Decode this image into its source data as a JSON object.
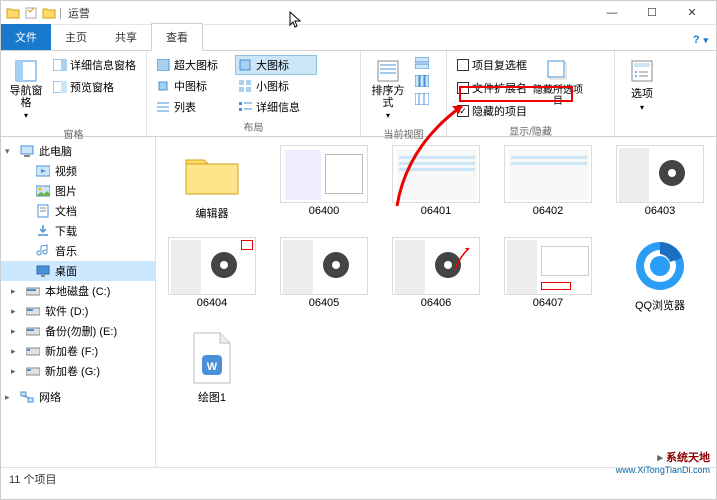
{
  "window": {
    "title": "运营",
    "minimize": "—",
    "maximize": "☐",
    "close": "✕"
  },
  "tabs": {
    "file": "文件",
    "home": "主页",
    "share": "共享",
    "view": "查看",
    "help": "?"
  },
  "ribbon": {
    "panes": {
      "nav_pane": "导航窗格",
      "detail_pane": "详细信息窗格",
      "preview_pane": "预览窗格",
      "label": "窗格"
    },
    "layout": {
      "extra_large": "超大图标",
      "large": "大图标",
      "medium": "中图标",
      "small": "小图标",
      "list": "列表",
      "details": "详细信息",
      "label": "布局"
    },
    "current_view": {
      "sort": "排序方式",
      "label": "当前视图"
    },
    "show_hide": {
      "item_checkboxes": "项目复选框",
      "file_ext": "文件扩展名",
      "hidden_items": "隐藏的项目",
      "hide_selected": "隐藏所选项目",
      "label": "显示/隐藏"
    },
    "options": "选项"
  },
  "nav": {
    "this_pc": "此电脑",
    "videos": "视频",
    "pictures": "图片",
    "documents": "文档",
    "downloads": "下载",
    "music": "音乐",
    "desktop": "桌面",
    "disk_c": "本地磁盘 (C:)",
    "disk_d": "软件 (D:)",
    "disk_e": "备份(勿删) (E:)",
    "disk_f": "新加卷 (F:)",
    "disk_g": "新加卷 (G:)",
    "network": "网络"
  },
  "files": [
    {
      "name": "编辑器",
      "type": "folder"
    },
    {
      "name": "06400",
      "type": "image"
    },
    {
      "name": "06401",
      "type": "image"
    },
    {
      "name": "06402",
      "type": "image"
    },
    {
      "name": "06403",
      "type": "image"
    },
    {
      "name": "06404",
      "type": "image"
    },
    {
      "name": "06405",
      "type": "image"
    },
    {
      "name": "06406",
      "type": "image"
    },
    {
      "name": "06407",
      "type": "image"
    },
    {
      "name": "QQ浏览器",
      "type": "app"
    },
    {
      "name": "绘图1",
      "type": "doc"
    }
  ],
  "status": {
    "count": "11 个项目"
  },
  "watermark": {
    "brand": "系统天地",
    "url": "www.XiTongTianDi.com"
  }
}
